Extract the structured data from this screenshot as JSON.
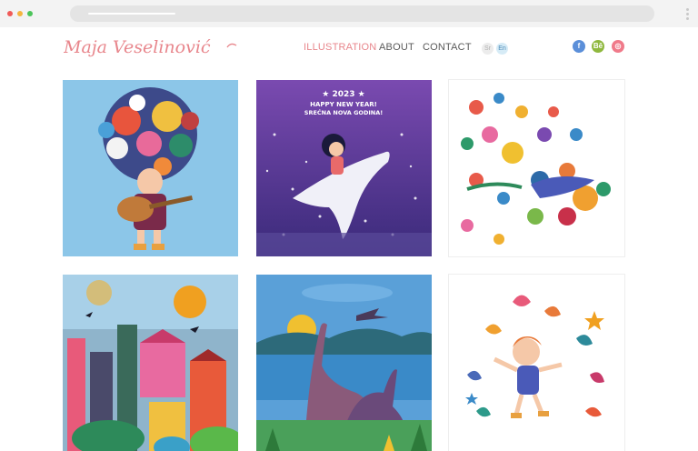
{
  "browser": {
    "dots": [
      "#f05a58",
      "#f5b53f",
      "#4cc45a"
    ]
  },
  "site": {
    "logo_text": "Maja Veselinović",
    "brand_color": "#e8868c"
  },
  "nav": {
    "items": [
      {
        "label": "ILLUSTRATION",
        "active": true
      },
      {
        "label": "ABOUT",
        "active": false
      },
      {
        "label": "CONTACT",
        "active": false
      }
    ]
  },
  "lang": {
    "items": [
      {
        "label": "Sr",
        "active": false
      },
      {
        "label": "En",
        "active": true
      }
    ]
  },
  "social": {
    "items": [
      {
        "icon": "facebook-icon",
        "glyph": "f",
        "color": "#5b8fd9"
      },
      {
        "icon": "behance-icon",
        "glyph": "Bē",
        "color": "#8fb83e"
      },
      {
        "icon": "instagram-icon",
        "glyph": "◎",
        "color": "#f07a8a"
      }
    ]
  },
  "gallery": {
    "tiles": [
      {
        "name": "girl-with-guitar-flowers"
      },
      {
        "name": "new-year-dove",
        "text_line1": "★ 2023 ★",
        "text_line2": "HAPPY NEW YEAR!",
        "text_line3": "SREĆNA NOVA GODINA!"
      },
      {
        "name": "flowers-birds-burst"
      },
      {
        "name": "colorful-village"
      },
      {
        "name": "dinosaur-lake"
      },
      {
        "name": "girl-with-leaves"
      }
    ]
  }
}
